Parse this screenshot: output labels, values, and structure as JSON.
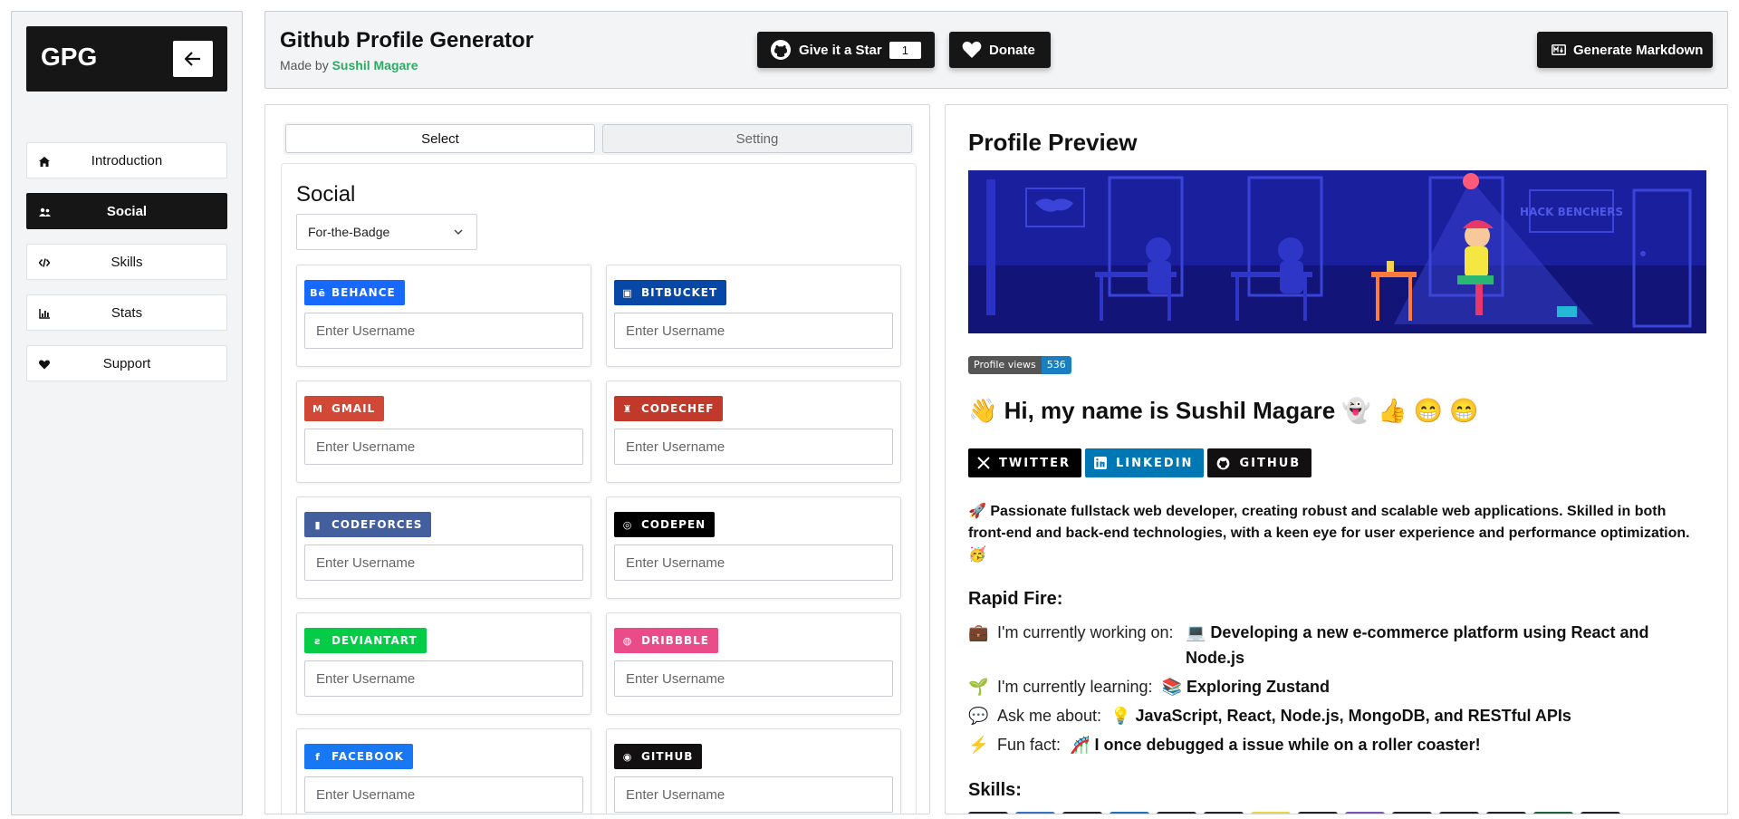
{
  "sidebar": {
    "logo": "GPG",
    "items": [
      {
        "label": "Introduction",
        "icon": "home-icon"
      },
      {
        "label": "Social",
        "icon": "users-icon"
      },
      {
        "label": "Skills",
        "icon": "code-icon"
      },
      {
        "label": "Stats",
        "icon": "chart-icon"
      },
      {
        "label": "Support",
        "icon": "heart-icon"
      }
    ],
    "active": "Social"
  },
  "header": {
    "title": "Github Profile Generator",
    "made_by_prefix": "Made by",
    "author": "Sushil Magare",
    "star_label": "Give it a Star",
    "star_count": "1",
    "donate_label": "Donate",
    "generate_label": "Generate Markdown"
  },
  "tabs": {
    "select": "Select",
    "setting": "Setting"
  },
  "social": {
    "title": "Social",
    "style_value": "For-the-Badge",
    "placeholder": "Enter Username",
    "platforms": [
      {
        "label": "BEHANCE",
        "color": "#1769ff",
        "glyph": "Bē"
      },
      {
        "label": "BITBUCKET",
        "color": "#0747a6",
        "glyph": "▣"
      },
      {
        "label": "GMAIL",
        "color": "#d14836",
        "glyph": "M"
      },
      {
        "label": "CODECHEF",
        "color": "#c0392b",
        "glyph": "♜"
      },
      {
        "label": "CODEFORCES",
        "color": "#445f9d",
        "glyph": "▮"
      },
      {
        "label": "CODEPEN",
        "color": "#000000",
        "glyph": "◎"
      },
      {
        "label": "DEVIANTART",
        "color": "#05cc47",
        "glyph": "ƨ"
      },
      {
        "label": "DRIBBBLE",
        "color": "#ea4c89",
        "glyph": "◍"
      },
      {
        "label": "FACEBOOK",
        "color": "#1877f2",
        "glyph": "f"
      },
      {
        "label": "GITHUB",
        "color": "#121011",
        "glyph": "◉"
      }
    ]
  },
  "preview": {
    "title": "Profile Preview",
    "views_label": "Profile views",
    "views_count": "536",
    "greeting": "👋 Hi, my name is Sushil Magare 👻 👍 😁 😁",
    "badges": [
      {
        "label": "TWITTER",
        "color": "#000000"
      },
      {
        "label": "LINKEDIN",
        "color": "#0077b5"
      },
      {
        "label": "GITHUB",
        "color": "#121011"
      }
    ],
    "about": "🚀 Passionate fullstack web developer, creating robust and scalable web applications. Skilled in both front-end and back-end technologies, with a keen eye for user experience and performance optimization. 🥳",
    "rapid_fire_title": "Rapid Fire:",
    "facts": [
      {
        "icon": "💼",
        "label": "I'm currently working on:",
        "value": "💻 Developing a new e-commerce platform using React and Node.js"
      },
      {
        "icon": "🌱",
        "label": "I'm currently learning:",
        "value": "📚 Exploring Zustand"
      },
      {
        "icon": "💬",
        "label": "Ask me about:",
        "value": "💡 JavaScript, React, Node.js, MongoDB, and RESTful APIs"
      },
      {
        "icon": "⚡",
        "label": "Fun fact:",
        "value": "🎢 I once debugged a issue while on a roller coaster!"
      }
    ],
    "skills_title": "Skills:",
    "banner_text": "HACK BENCHERS"
  }
}
